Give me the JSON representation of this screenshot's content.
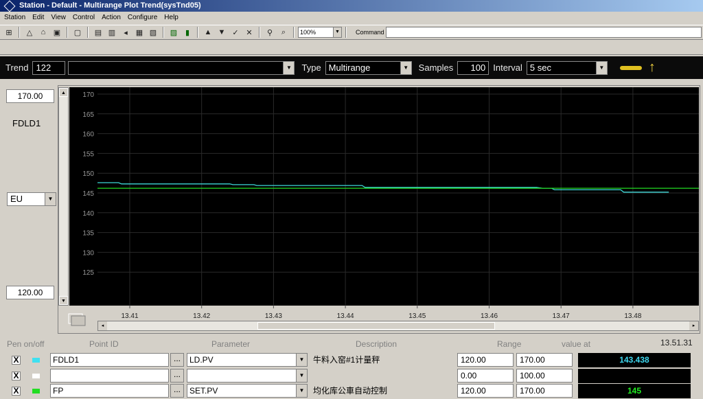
{
  "window": {
    "title": "Station - Default - Multirange Plot Trend(sysTnd05)"
  },
  "menu": [
    "Station",
    "Edit",
    "View",
    "Control",
    "Action",
    "Configure",
    "Help"
  ],
  "toolbar": {
    "zoom": "100%",
    "command_label": "Command"
  },
  "trendbar": {
    "trend_label": "Trend",
    "trend_number": "122",
    "trend_name": "",
    "type_label": "Type",
    "type_value": "Multirange",
    "samples_label": "Samples",
    "samples_value": "100",
    "interval_label": "Interval",
    "interval_value": "5 sec"
  },
  "left_panel": {
    "high_value": "170.00",
    "pen_label": "FDLD1",
    "eu": "EU",
    "low_value": "120.00"
  },
  "table": {
    "headers": {
      "pen": "Pen on/off",
      "point": "Point ID",
      "parameter": "Parameter",
      "description": "Description",
      "range": "Range",
      "value": "value at"
    },
    "clock": "13.51.31",
    "rows": [
      {
        "checked": "X",
        "color": "#40e0f0",
        "point": "FDLD1",
        "parameter": "LD.PV",
        "description": "牛料入窑#1计量秤",
        "range_lo": "120.00",
        "range_hi": "170.00",
        "value": "143.438",
        "value_color": "#3ed8f0"
      },
      {
        "checked": "X",
        "color": "#ffffff",
        "point": "",
        "parameter": "",
        "description": "",
        "range_lo": "0.00",
        "range_hi": "100.00",
        "value": "",
        "value_color": "#ffffff"
      },
      {
        "checked": "X",
        "color": "#22dd22",
        "point": "FP",
        "parameter": "SET.PV",
        "description": "均化库公車自动控制",
        "range_lo": "120.00",
        "range_hi": "170.00",
        "value": "145",
        "value_color": "#22ee22"
      }
    ]
  },
  "chart_data": {
    "type": "line",
    "ylim": [
      120,
      170
    ],
    "yticks": [
      "170",
      "165",
      "160",
      "155",
      "150",
      "145",
      "140",
      "135",
      "130",
      "125"
    ],
    "xticks": [
      "13.41",
      "13.42",
      "13.43",
      "13.44",
      "13.45",
      "13.46",
      "13.47",
      "13.48"
    ],
    "grid": true,
    "series": [
      {
        "color": "#3ed8d8",
        "x": [
          0,
          0.035,
          0.04,
          0.22,
          0.225,
          0.26,
          0.265,
          0.44,
          0.445,
          0.73,
          0.74,
          0.755,
          0.76,
          0.87,
          0.875,
          0.93,
          0.95
        ],
        "y": [
          147.6,
          147.6,
          147.3,
          147.3,
          147.1,
          147.1,
          146.9,
          146.9,
          146.4,
          146.4,
          146.2,
          146.2,
          145.8,
          145.8,
          145.2,
          145.2,
          145.2
        ]
      },
      {
        "color": "#22dd22",
        "x": [
          0,
          1
        ],
        "y": [
          146.2,
          146.2
        ]
      }
    ]
  }
}
